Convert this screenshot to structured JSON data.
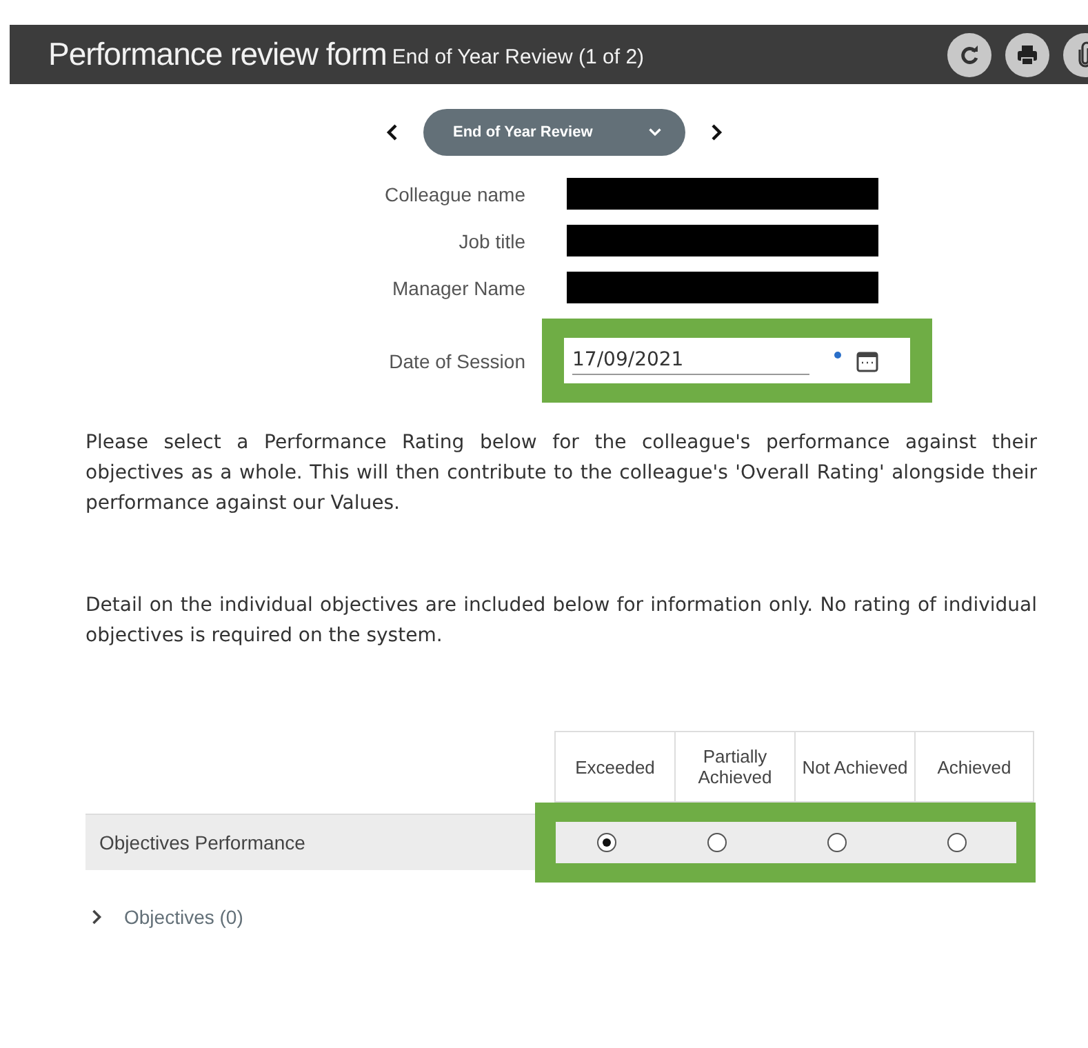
{
  "header": {
    "title": "Performance review form",
    "subtitle": "End of Year Review (1 of 2)"
  },
  "nav": {
    "stage": "End of Year Review"
  },
  "fields": [
    {
      "label": "Colleague name",
      "kind": "redacted"
    },
    {
      "label": "Job title",
      "kind": "redacted"
    },
    {
      "label": "Manager Name",
      "kind": "redacted"
    },
    {
      "label": "Date of Session",
      "kind": "date",
      "value": "17/09/2021",
      "highlighted": true
    }
  ],
  "paragraphs": [
    "Please select a Performance Rating below for the colleague's performance against their objectives as a whole. This will then contribute to the colleague's 'Overall Rating' alongside their performance against our Values.",
    "Detail on the individual objectives are included below for information only. No rating of individual objectives is required on the system."
  ],
  "rating": {
    "columns": [
      "Exceeded",
      "Partially Achieved",
      "Not Achieved",
      "Achieved"
    ],
    "row_label": "Objectives Performance",
    "highlighted": true,
    "options": [
      {
        "selected": true
      },
      {
        "selected": false
      },
      {
        "selected": false
      },
      {
        "selected": false
      }
    ]
  },
  "section": {
    "label": "Objectives (0)",
    "expanded": false
  }
}
